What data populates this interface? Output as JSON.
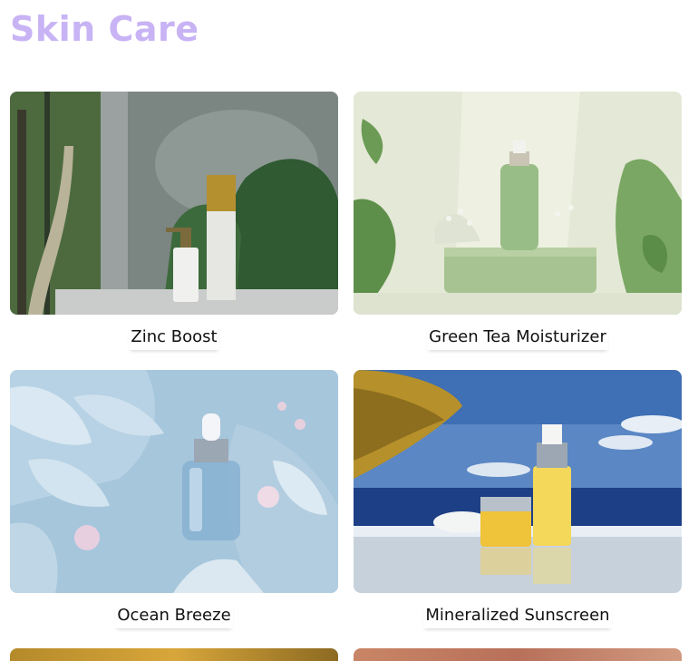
{
  "page": {
    "title": "Skin Care"
  },
  "products": [
    {
      "name": "Zinc Boost",
      "image": "zinc-boost-product-image"
    },
    {
      "name": "Green Tea Moisturizer",
      "image": "green-tea-moisturizer-product-image"
    },
    {
      "name": "Ocean Breeze",
      "image": "ocean-breeze-product-image"
    },
    {
      "name": "Mineralized Sunscreen",
      "image": "mineralized-sunscreen-product-image"
    }
  ]
}
